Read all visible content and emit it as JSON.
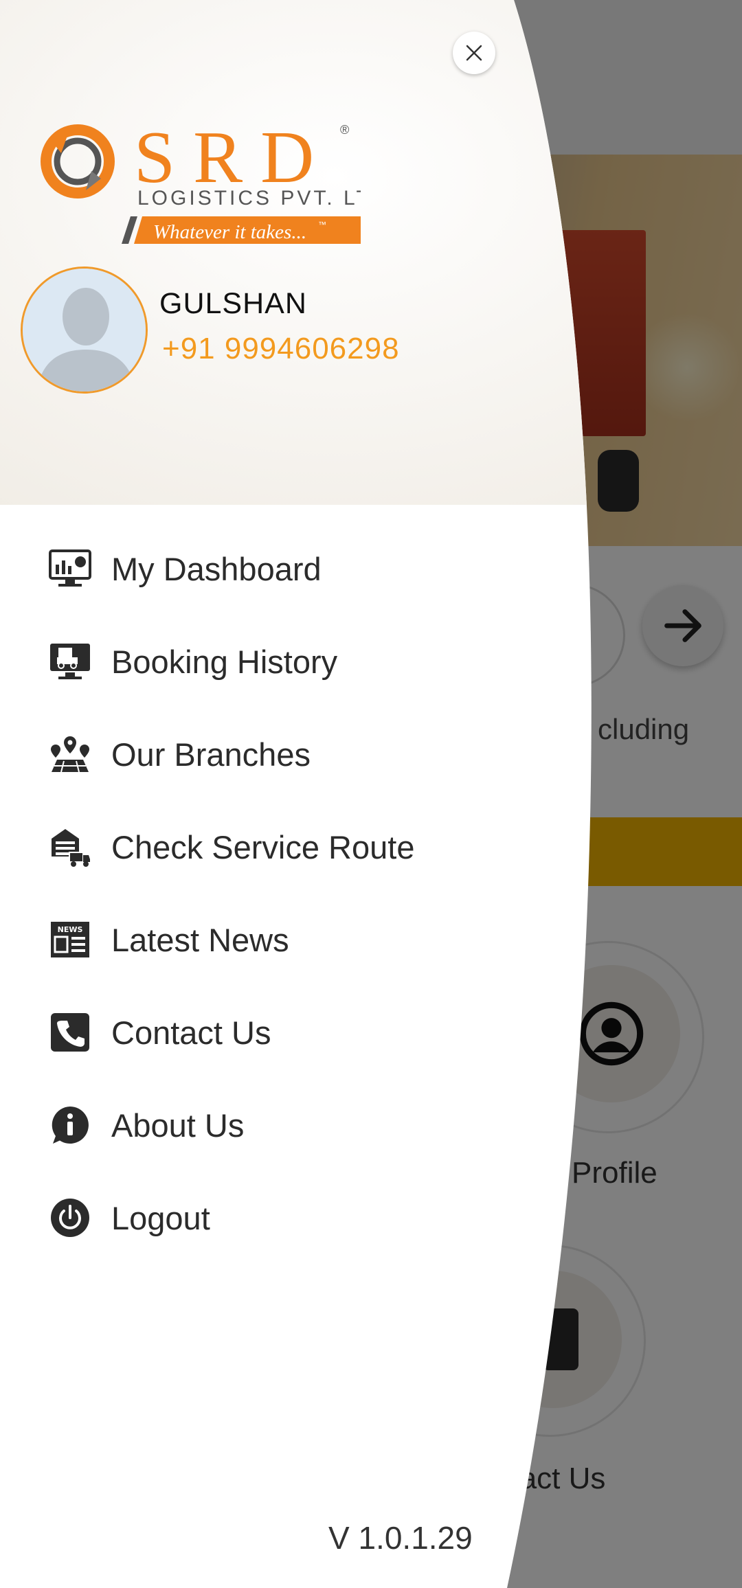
{
  "background": {
    "partial_text_including": "cluding",
    "profile_label": "Profile",
    "contact_label": "ntact Us"
  },
  "drawer": {
    "brand": {
      "name": "SRD",
      "registered": "®",
      "subtitle": "LOGISTICS PVT. LTD.",
      "tagline": "Whatever it takes...",
      "tagline_tm": "™"
    },
    "user": {
      "name": "GULSHAN",
      "phone": "+91 9994606298"
    },
    "menu": [
      {
        "label": "My Dashboard",
        "icon": "dashboard-icon"
      },
      {
        "label": "Booking History",
        "icon": "booking-history-icon"
      },
      {
        "label": "Our Branches",
        "icon": "branches-icon"
      },
      {
        "label": "Check Service Route",
        "icon": "service-route-icon"
      },
      {
        "label": "Latest News",
        "icon": "news-icon"
      },
      {
        "label": "Contact Us",
        "icon": "phone-icon"
      },
      {
        "label": "About Us",
        "icon": "info-icon"
      },
      {
        "label": "Logout",
        "icon": "power-icon"
      }
    ],
    "version": "V 1.0.1.29"
  },
  "colors": {
    "brand_orange": "#f0821e",
    "phone_orange": "#f39a1e",
    "drawer_header_bg": "#f3f0ea",
    "menu_text": "#2b2b2b"
  }
}
